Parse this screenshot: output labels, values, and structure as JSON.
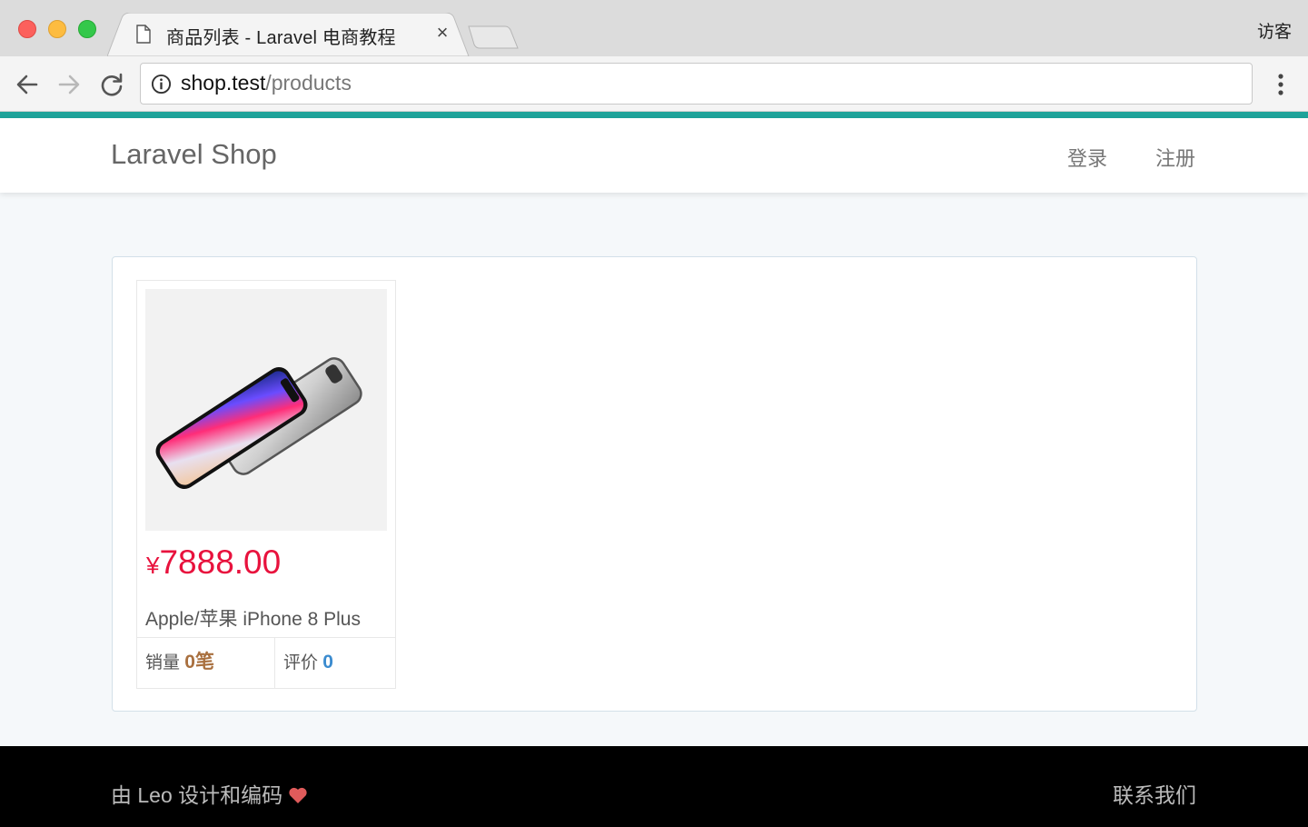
{
  "browser": {
    "tab_title": "商品列表 - Laravel 电商教程",
    "tab_close": "×",
    "profile_label": "访客",
    "url_host": "shop.test",
    "url_path": "/products",
    "accent_color": "#1ea39a"
  },
  "navbar": {
    "brand": "Laravel Shop",
    "login": "登录",
    "register": "注册"
  },
  "products": [
    {
      "image": "iphone-x-photo",
      "currency": "¥",
      "price": "7888.00",
      "title": "Apple/苹果 iPhone 8 Plus",
      "sales_label": "销量",
      "sales_value": "0笔",
      "reviews_label": "评价",
      "reviews_value": "0"
    }
  ],
  "footer": {
    "credit": "由 Leo 设计和编码",
    "contact": "联系我们"
  },
  "colors": {
    "price": "#e8123d",
    "sales": "#a9703f",
    "reviews": "#3b8bcf",
    "heart": "#e05b5b"
  }
}
